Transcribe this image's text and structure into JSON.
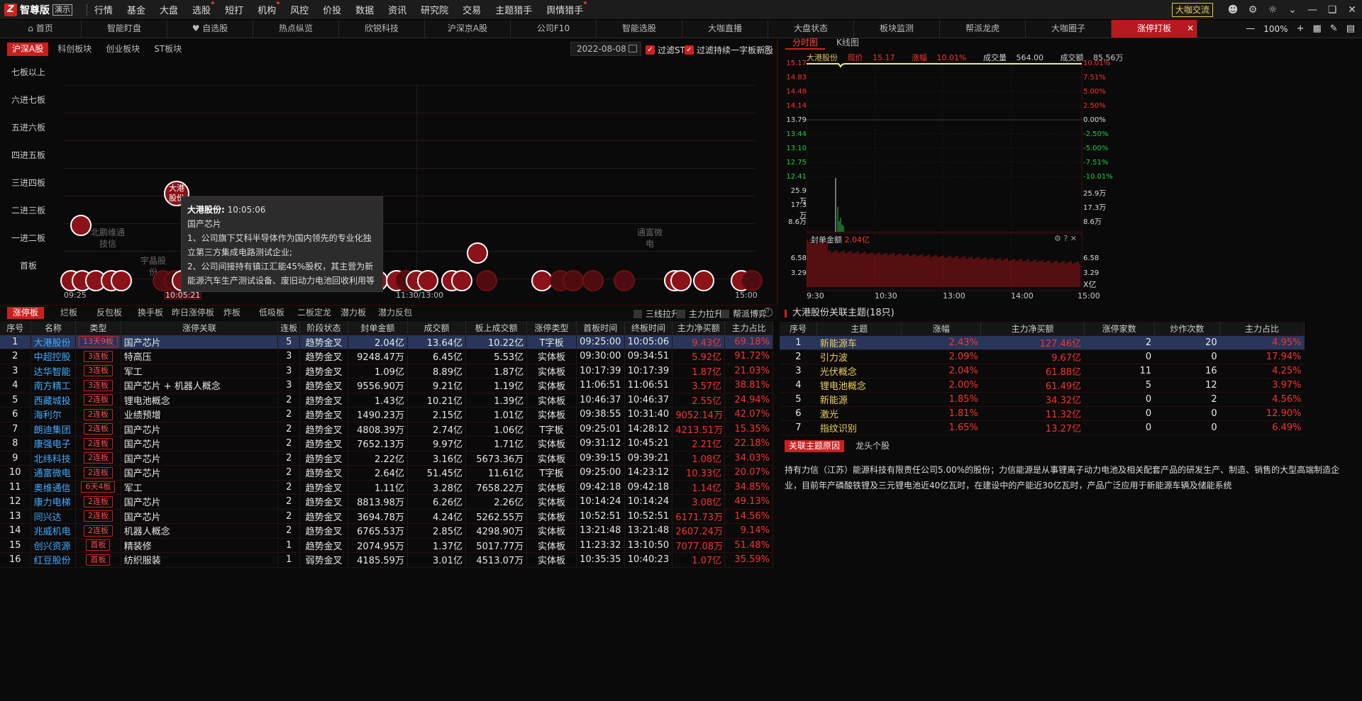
{
  "app": {
    "name": "智尊版",
    "demo": "演示",
    "right_btn": "大咖交流"
  },
  "menu": [
    {
      "label": "行情",
      "dot": false
    },
    {
      "label": "基金",
      "dot": false
    },
    {
      "label": "大盘",
      "dot": false
    },
    {
      "label": "选股",
      "dot": true
    },
    {
      "label": "短打",
      "dot": false
    },
    {
      "label": "机构",
      "dot": true
    },
    {
      "label": "风控",
      "dot": false
    },
    {
      "label": "价投",
      "dot": false
    },
    {
      "label": "数据",
      "dot": false
    },
    {
      "label": "资讯",
      "dot": false
    },
    {
      "label": "研究院",
      "dot": false
    },
    {
      "label": "交易",
      "dot": false
    },
    {
      "label": "主题猎手",
      "dot": false
    },
    {
      "label": "舆情猎手",
      "dot": true
    }
  ],
  "tabs": [
    "首页",
    "智能盯盘",
    "自选股",
    "热点纵览",
    "欣锐科技",
    "沪深京A股",
    "公司F10",
    "智能选股",
    "大咖直播",
    "大盘状态",
    "板块监测",
    "帮派龙虎",
    "大咖圈子",
    "涨停打板"
  ],
  "zoom": "100%",
  "ladder": {
    "subtabs": [
      "沪深A股",
      "科创板块",
      "创业板块",
      "ST板块"
    ],
    "date": "2022-08-08",
    "filters": [
      "过滤ST",
      "过滤持续一字板新股"
    ],
    "ylabels": [
      "七板以上",
      "六进七板",
      "五进六板",
      "四进五板",
      "三进四板",
      "二进三板",
      "一进二板",
      "首板"
    ],
    "xlabels": [
      "09:25",
      "10:05:21",
      "11:30/13:00",
      "15:00"
    ],
    "ghost_labels": [
      "北鹏维通\n技信",
      "通富微\n电",
      "宇晶股\n份"
    ],
    "highlight": {
      "name": "大港股份"
    },
    "tooltip": {
      "title": "大港股份:",
      "time": "10:05:06",
      "theme": "国产芯片",
      "line1": "1、公司旗下艾科半导体作为国内领先的专业化独立第三方集成电路测试企业;",
      "line2": "2、公司间接持有镇江汇能45%股权，其主营为新能源汽车生产测试设备、废旧动力电池回收利用等"
    }
  },
  "bottom_tabs": [
    "涨停板",
    "烂板",
    "反包板",
    "换手板",
    "昨日涨停板",
    "炸板",
    "低吸板",
    "二板定龙",
    "潜力板",
    "潜力反包"
  ],
  "bottom_checks": [
    "三线拉升",
    "主力拉升",
    "帮派博弈"
  ],
  "table": {
    "headers": [
      "序号",
      "名称",
      "类型",
      "涨停关联",
      "连板",
      "阶段状态",
      "封单金额",
      "成交额",
      "板上成交额",
      "涨停类型",
      "首板时间",
      "终板时间",
      "主力净买额",
      "主力占比"
    ],
    "rows": [
      [
        "1",
        "大港股份",
        "13天9板",
        "国产芯片",
        "5",
        "趋势金叉",
        "2.04亿",
        "13.64亿",
        "10.22亿",
        "T字板",
        "09:25:00",
        "10:05:06",
        "9.43亿",
        "69.18%"
      ],
      [
        "2",
        "中超控股",
        "3连板",
        "特高压",
        "3",
        "趋势金叉",
        "9248.47万",
        "6.45亿",
        "5.53亿",
        "实体板",
        "09:30:00",
        "09:34:51",
        "5.92亿",
        "91.72%"
      ],
      [
        "3",
        "达华智能",
        "3连板",
        "军工",
        "3",
        "趋势金叉",
        "1.09亿",
        "8.89亿",
        "1.87亿",
        "实体板",
        "10:17:39",
        "10:17:39",
        "1.87亿",
        "21.03%"
      ],
      [
        "4",
        "南方精工",
        "3连板",
        "国产芯片 + 机器人概念",
        "3",
        "趋势金叉",
        "9556.90万",
        "9.21亿",
        "1.19亿",
        "实体板",
        "11:06:51",
        "11:06:51",
        "3.57亿",
        "38.81%"
      ],
      [
        "5",
        "西藏城投",
        "2连板",
        "锂电池概念",
        "2",
        "趋势金叉",
        "1.43亿",
        "10.21亿",
        "1.39亿",
        "实体板",
        "10:46:37",
        "10:46:37",
        "2.55亿",
        "24.94%"
      ],
      [
        "6",
        "海利尔",
        "2连板",
        "业绩预增",
        "2",
        "趋势金叉",
        "1490.23万",
        "2.15亿",
        "1.01亿",
        "实体板",
        "09:38:55",
        "10:31:40",
        "9052.14万",
        "42.07%"
      ],
      [
        "7",
        "朗迪集团",
        "2连板",
        "国产芯片",
        "2",
        "趋势金叉",
        "4808.39万",
        "2.74亿",
        "1.06亿",
        "T字板",
        "09:25:01",
        "14:28:12",
        "4213.51万",
        "15.35%"
      ],
      [
        "8",
        "康强电子",
        "2连板",
        "国产芯片",
        "2",
        "趋势金叉",
        "7652.13万",
        "9.97亿",
        "1.71亿",
        "实体板",
        "09:31:12",
        "10:45:21",
        "2.21亿",
        "22.18%"
      ],
      [
        "9",
        "北纬科技",
        "2连板",
        "国产芯片",
        "2",
        "趋势金叉",
        "2.22亿",
        "3.16亿",
        "5673.36万",
        "实体板",
        "09:39:15",
        "09:39:21",
        "1.08亿",
        "34.03%"
      ],
      [
        "10",
        "通富微电",
        "2连板",
        "国产芯片",
        "2",
        "趋势金叉",
        "2.64亿",
        "51.45亿",
        "11.61亿",
        "T字板",
        "09:25:00",
        "14:23:12",
        "10.33亿",
        "20.07%"
      ],
      [
        "11",
        "奥维通信",
        "6天4板",
        "军工",
        "2",
        "趋势金叉",
        "1.11亿",
        "3.28亿",
        "7658.22万",
        "实体板",
        "09:42:18",
        "09:42:18",
        "1.14亿",
        "34.85%"
      ],
      [
        "12",
        "康力电梯",
        "2连板",
        "国产芯片",
        "2",
        "趋势金叉",
        "8813.98万",
        "6.26亿",
        "2.26亿",
        "实体板",
        "10:14:24",
        "10:14:24",
        "3.08亿",
        "49.13%"
      ],
      [
        "13",
        "同兴达",
        "2连板",
        "国产芯片",
        "2",
        "趋势金叉",
        "3694.78万",
        "4.24亿",
        "5262.55万",
        "实体板",
        "10:52:51",
        "10:52:51",
        "6171.73万",
        "14.56%"
      ],
      [
        "14",
        "兆威机电",
        "2连板",
        "机器人概念",
        "2",
        "趋势金叉",
        "6765.53万",
        "2.85亿",
        "4298.90万",
        "实体板",
        "13:21:48",
        "13:21:48",
        "2607.24万",
        "9.14%"
      ],
      [
        "15",
        "创兴资源",
        "首板",
        "精装修",
        "1",
        "趋势金叉",
        "2074.95万",
        "1.37亿",
        "5017.77万",
        "实体板",
        "11:23:32",
        "13:10:50",
        "7077.08万",
        "51.48%"
      ],
      [
        "16",
        "红豆股份",
        "首板",
        "纺织服装",
        "1",
        "弱势金叉",
        "4185.59万",
        "3.01亿",
        "4513.07万",
        "实体板",
        "10:35:35",
        "10:40:23",
        "1.07亿",
        "35.59%"
      ]
    ]
  },
  "chart": {
    "tabs": [
      "分时图",
      "K线图"
    ],
    "stock": "大港股份",
    "price_label": "现价",
    "price": "15.17",
    "chg_label": "涨幅",
    "chg": "10.01%",
    "vol_label": "成交量",
    "vol": "564.00",
    "amt_label": "成交额",
    "amt": "85.56万",
    "left_axis": [
      "15.17",
      "14.83",
      "14.48",
      "14.14",
      "13.79",
      "13.44",
      "13.10",
      "12.75",
      "12.41"
    ],
    "right_axis": [
      "10.01%",
      "7.51%",
      "5.00%",
      "2.50%",
      "0.00%",
      "-2.50%",
      "-5.00%",
      "-7.51%",
      "-10.01%"
    ],
    "vol_axis": [
      "25.9万",
      "17.3万",
      "8.6万"
    ],
    "seal_label": "封单金额",
    "seal_value": "2.04亿",
    "seal_axis": [
      "6.58",
      "3.29"
    ],
    "seal_unit": "X亿",
    "time_axis": [
      "9:30",
      "10:30",
      "13:00",
      "14:00",
      "15:00"
    ],
    "colors": {
      "up": "#ff3030",
      "down": "#22cc44",
      "price_line": "#e8e8a0"
    }
  },
  "related": {
    "title": "大港股份关联主题(18只)",
    "headers": [
      "序号",
      "主题",
      "涨幅",
      "主力净买额",
      "涨停家数",
      "炒作次数",
      "主力占比"
    ],
    "rows": [
      [
        "1",
        "新能源车",
        "2.43%",
        "127.46亿",
        "2",
        "20",
        "4.95%"
      ],
      [
        "2",
        "引力波",
        "2.09%",
        "9.67亿",
        "0",
        "0",
        "17.94%"
      ],
      [
        "3",
        "光伏概念",
        "2.04%",
        "61.88亿",
        "11",
        "16",
        "4.25%"
      ],
      [
        "4",
        "锂电池概念",
        "2.00%",
        "61.49亿",
        "5",
        "12",
        "3.97%"
      ],
      [
        "5",
        "新能源",
        "1.85%",
        "34.32亿",
        "0",
        "2",
        "4.56%"
      ],
      [
        "6",
        "激光",
        "1.81%",
        "11.32亿",
        "0",
        "0",
        "12.90%"
      ],
      [
        "7",
        "指纹识别",
        "1.65%",
        "13.27亿",
        "0",
        "0",
        "6.49%"
      ]
    ],
    "reason_tabs": [
      "关联主题原因",
      "龙头个股"
    ],
    "reason": "持有力信（江苏）能源科技有限责任公司5.00%的股份；力信能源是从事锂离子动力电池及相关配套产品的研发生产、制造、销售的大型高端制造企业，目前年产磷酸铁锂及三元锂电池近40亿瓦时，在建设中的产能近30亿瓦时，产品广泛应用于新能源车辆及储能系统"
  }
}
